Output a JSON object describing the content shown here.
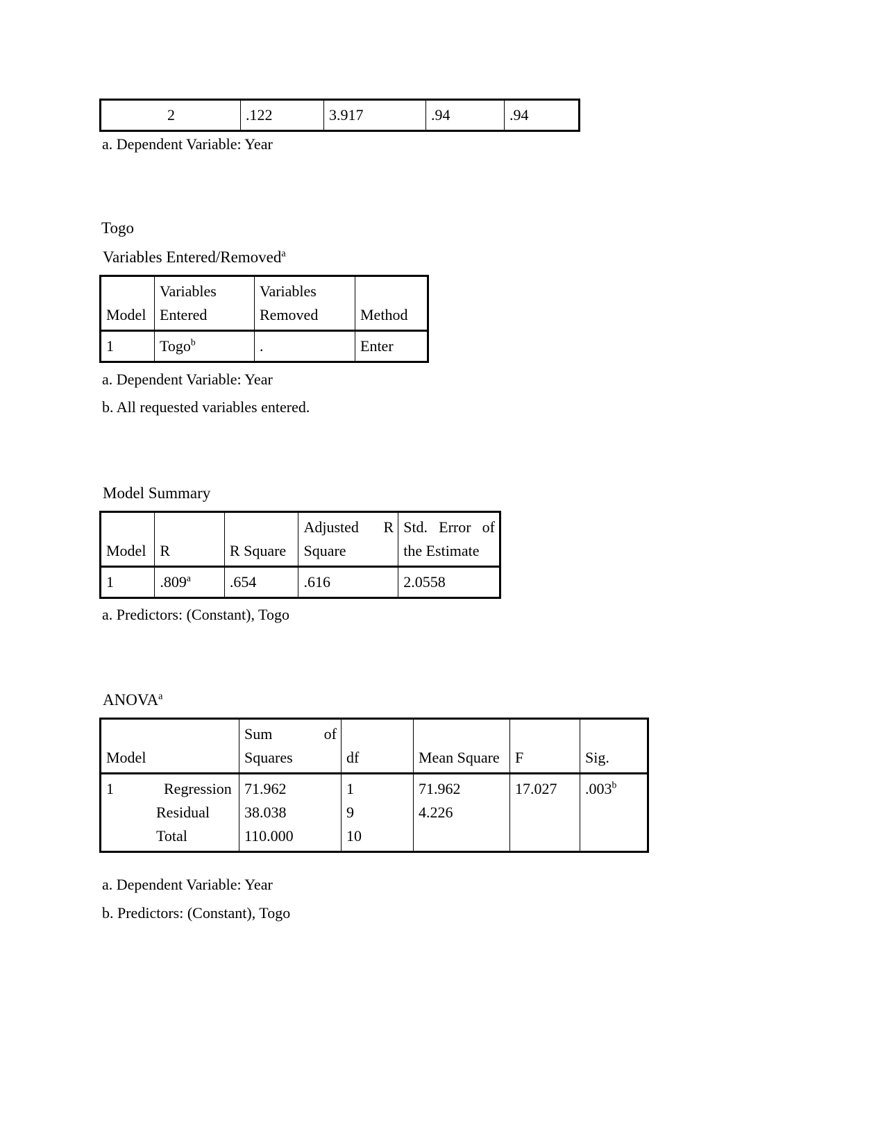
{
  "top_table": {
    "row": [
      "2",
      ".122",
      "3.917",
      ".94",
      ".94"
    ],
    "footnotes": [
      "a. Dependent Variable: Year"
    ]
  },
  "section": {
    "heading": "Togo"
  },
  "variables_table": {
    "caption": "Variables Entered/Removed",
    "caption_sup": "a",
    "headers": {
      "model": "Model",
      "entered_line1": "Variables",
      "entered_line2": "Entered",
      "removed_line1": "Variables",
      "removed_line2": "Removed",
      "method": "Method"
    },
    "rows": [
      {
        "model": "1",
        "entered": "Togo",
        "entered_sup": "b",
        "removed": ".",
        "method": "Enter"
      }
    ],
    "footnotes": [
      "a. Dependent Variable: Year",
      "b. All requested variables entered."
    ]
  },
  "model_summary": {
    "caption": "Model Summary",
    "headers": {
      "model": "Model",
      "r": "R",
      "r_square": "R Square",
      "adj_line1": "Adjusted        R",
      "adj_line2": "Square",
      "stderr_line1": "Std.  Error  of",
      "stderr_line2": "the Estimate"
    },
    "rows": [
      {
        "model": "1",
        "r": ".809",
        "r_sup": "a",
        "r_square": ".654",
        "adj_r_square": ".616",
        "std_error": "2.0558"
      }
    ],
    "footnotes": [
      "a. Predictors: (Constant), Togo"
    ]
  },
  "anova": {
    "caption": "ANOVA",
    "caption_sup": "a",
    "headers": {
      "model": "Model",
      "sum_line1": "Sum           of",
      "sum_line2": "Squares",
      "df": "df",
      "mean_square": "Mean Square",
      "f": "F",
      "sig": "Sig."
    },
    "rows": [
      {
        "model": "1",
        "source": "Regression",
        "sum_of_squares": "71.962",
        "df": "1",
        "mean_square": "71.962",
        "f": "17.027",
        "sig": ".003",
        "sig_sup": "b"
      },
      {
        "model": "",
        "source": "Residual",
        "sum_of_squares": "38.038",
        "df": "9",
        "mean_square": "4.226",
        "f": "",
        "sig": "",
        "sig_sup": ""
      },
      {
        "model": "",
        "source": "Total",
        "sum_of_squares": "110.000",
        "df": "10",
        "mean_square": "",
        "f": "",
        "sig": "",
        "sig_sup": ""
      }
    ],
    "footnotes": [
      "a. Dependent Variable: Year",
      "b. Predictors: (Constant), Togo"
    ]
  }
}
